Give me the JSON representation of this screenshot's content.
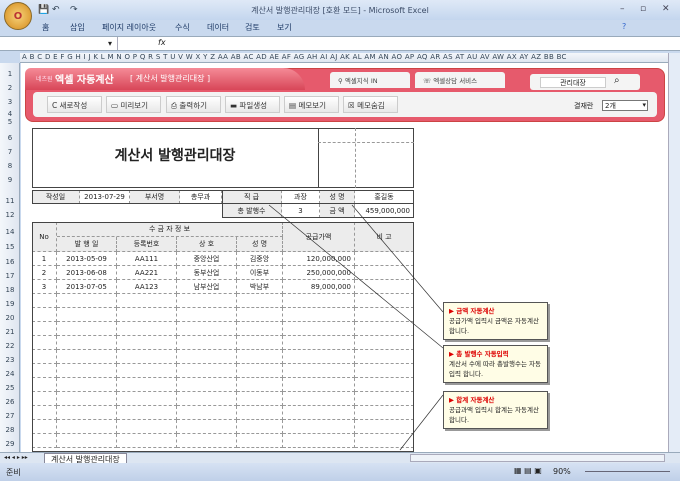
{
  "window": {
    "title": "계산서 발행관리대장 [호환 모드] - Microsoft Excel",
    "office_button": "O"
  },
  "ribbon_tabs": [
    "홈",
    "삽입",
    "페이지 레이아웃",
    "수식",
    "데이터",
    "검토",
    "보기"
  ],
  "formula_bar": {
    "fx": "fx",
    "value": ""
  },
  "columns": "A B C D E F G H I J K L M N O P Q R S T U V W X Y Z AA AB AC AD AE AF AG AH AI AJ AK AL AM AN AO AP AQ AR AS AT AU AV AW AX AY AZ BB BC",
  "rows": [
    "1",
    "2",
    "3",
    "4",
    "5",
    "6",
    "7",
    "8",
    "9",
    "11",
    "12",
    "14",
    "15",
    "16",
    "17",
    "18",
    "19",
    "20",
    "21",
    "22",
    "23",
    "24",
    "25",
    "26",
    "27",
    "28",
    "29"
  ],
  "banner": {
    "brand_small": "네츠원",
    "brand": "엑셀 자동계산",
    "subtitle": "[ 계산서 발행관리대장 ]",
    "nav1": "엑셀지식 IN",
    "nav2": "엑셀상담 서비스",
    "search_value": "관리대장"
  },
  "toolbar": {
    "new": "새로작성",
    "preview": "미리보기",
    "print": "출력하기",
    "file": "파일생성",
    "memo_show": "메모보기",
    "memo_hide": "메모숨김",
    "result_label": "결재란",
    "result_value": "2개"
  },
  "doc": {
    "title": "계산서 발행관리대장",
    "info": {
      "date_label": "작성일",
      "date": "2013-07-29",
      "dept_label": "부서명",
      "dept": "총무과",
      "rank_label": "직 급",
      "rank": "과장",
      "name_label": "성 명",
      "name": "홍길동",
      "count_label": "총 발행수",
      "count": "3",
      "amount_label": "금 액",
      "amount": "459,000,000"
    },
    "headers": {
      "no": "No",
      "group": "수 금 자  정 보",
      "date": "발 행 일",
      "reg": "등록번호",
      "company": "상 호",
      "person": "성 명",
      "supply": "공급가액",
      "note": "비 고"
    },
    "rows": [
      {
        "no": "1",
        "date": "2013-05-09",
        "reg": "AA111",
        "company": "중앙산업",
        "person": "김중앙",
        "supply": "120,000,000"
      },
      {
        "no": "2",
        "date": "2013-06-08",
        "reg": "AA221",
        "company": "동부산업",
        "person": "이동부",
        "supply": "250,000,000"
      },
      {
        "no": "3",
        "date": "2013-07-05",
        "reg": "AA123",
        "company": "남부산업",
        "person": "박남부",
        "supply": "89,000,000"
      }
    ]
  },
  "notes": [
    {
      "title": "금액 자동계산",
      "body": "공급가액 입력시 금액은 자동계산합니다."
    },
    {
      "title": "총 발행수 자동입력",
      "body": "계산서 수에 따라 총발행수는 자동입력 합니다."
    },
    {
      "title": "합계 자동계산",
      "body": "공급과액 입력시 합계는 자동계산 합니다."
    }
  ],
  "sheet_tab": "계산서 발행관리대장",
  "status": {
    "ready": "준비",
    "zoom": "90%"
  }
}
